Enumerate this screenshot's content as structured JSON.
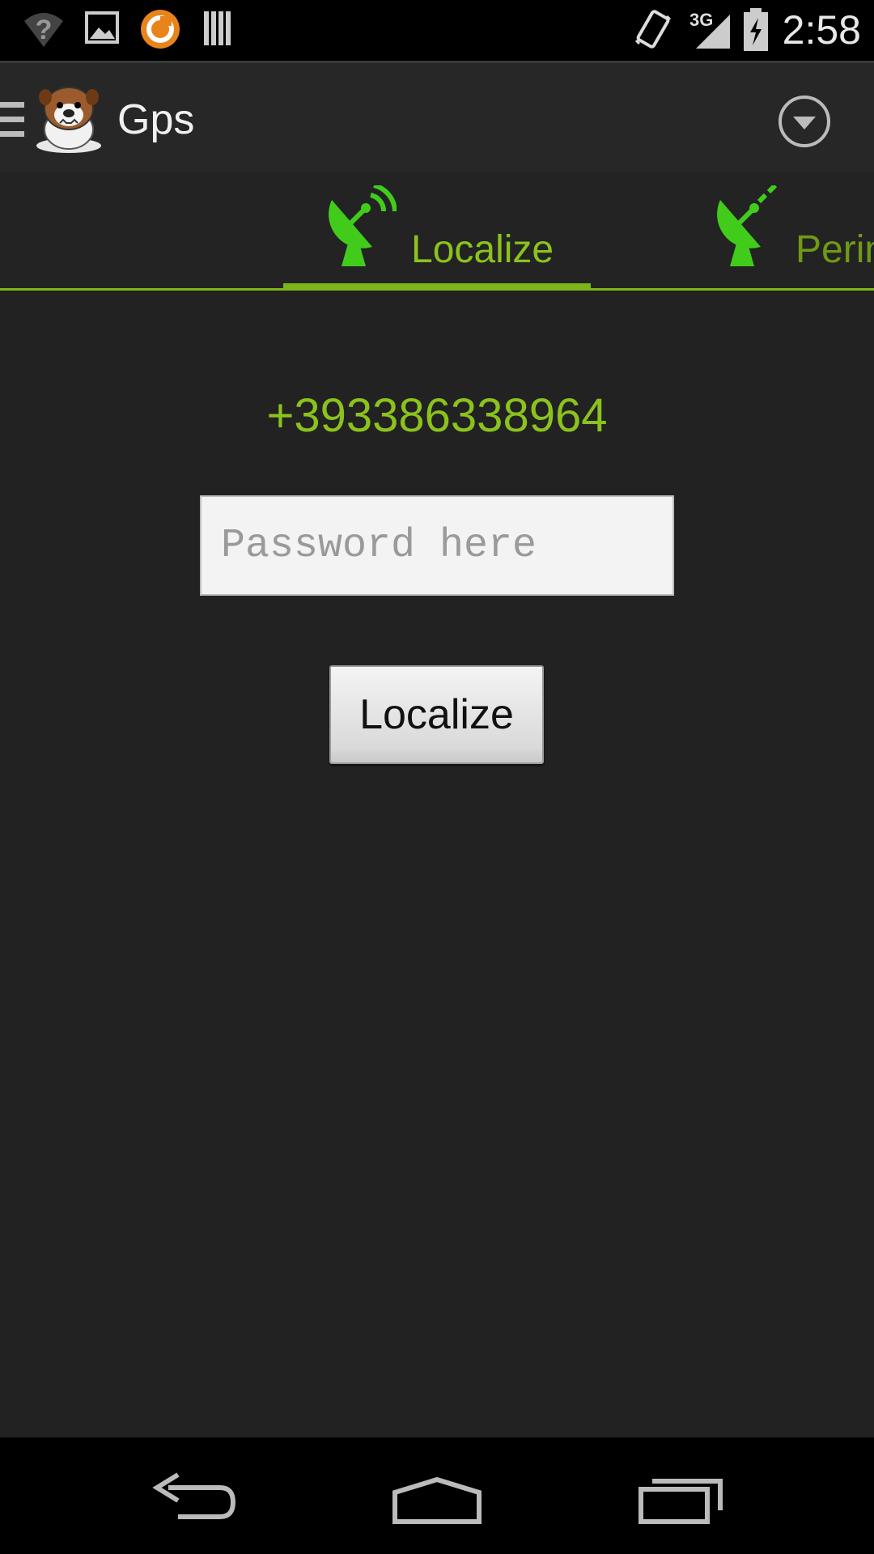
{
  "status_bar": {
    "time": "2:58",
    "network_type": "3G",
    "icons": [
      "wifi-question-icon",
      "gallery-icon",
      "orange-app-icon",
      "barcode-icon",
      "vibrate-icon",
      "signal-icon",
      "battery-charging-icon"
    ]
  },
  "action_bar": {
    "title": "Gps",
    "logo": "bulldog-logo",
    "overflow_icon": "dropdown-circle-icon"
  },
  "tabs": [
    {
      "label": "Localize",
      "icon": "satellite-dish-icon",
      "selected": true
    },
    {
      "label": "Perim",
      "icon": "satellite-dish-icon",
      "selected": false
    }
  ],
  "main": {
    "phone_number": "+393386338964",
    "password_placeholder": "Password here",
    "password_value": "",
    "button_label": "Localize"
  },
  "nav_bar": {
    "icons": [
      "back-icon",
      "home-icon",
      "recents-icon"
    ]
  },
  "colors": {
    "accent": "#8bc21c",
    "background": "#222222",
    "status_bar": "#000000"
  }
}
